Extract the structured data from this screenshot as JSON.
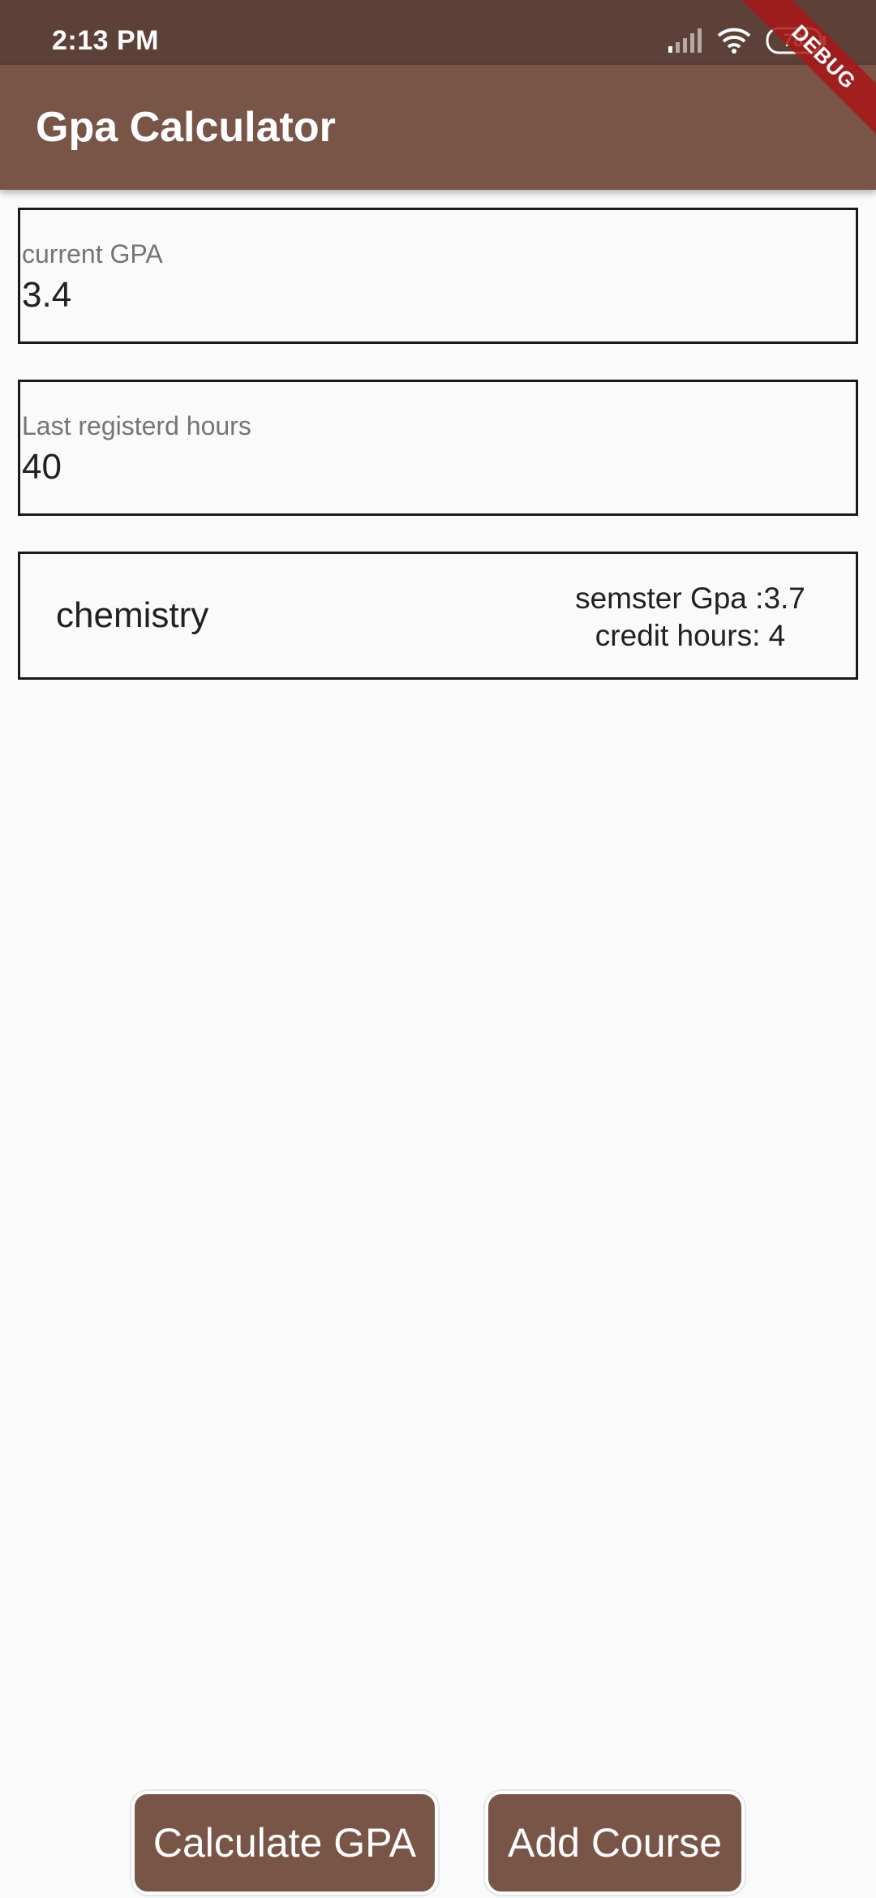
{
  "status_bar": {
    "time": "2:13 PM",
    "battery": "78",
    "icons": [
      "signal-icon",
      "wifi-icon",
      "battery-icon"
    ],
    "background": "#5d4037"
  },
  "app_bar": {
    "title": "Gpa Calculator",
    "background": "#795548"
  },
  "debug_ribbon": {
    "label": "DEBUG",
    "color": "#a81717"
  },
  "current_gpa": {
    "label": "current GPA",
    "value": "3.4"
  },
  "last_hours": {
    "label": "Last registerd hours",
    "value": "40"
  },
  "courses": [
    {
      "name": "chemistry",
      "semester_gpa": "semster Gpa :3.7",
      "credit_hours": "credit hours: 4"
    }
  ],
  "buttons": {
    "calculate": "Calculate GPA",
    "add_course": "Add Course",
    "color": "#795548"
  }
}
